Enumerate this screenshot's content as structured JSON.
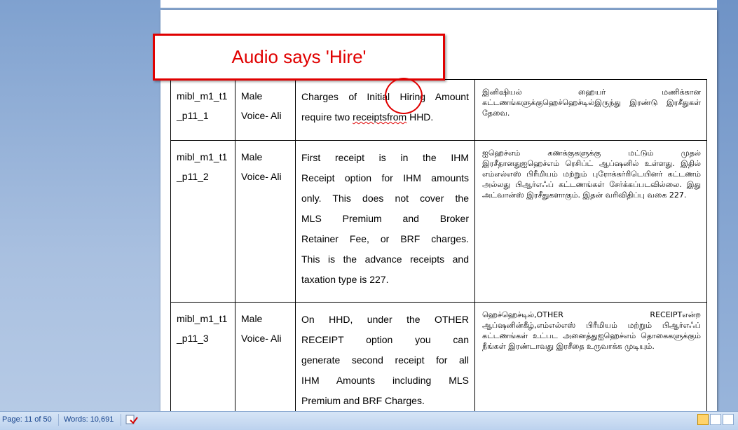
{
  "callout": {
    "text": "Audio says 'Hire'"
  },
  "table": {
    "rows": [
      {
        "id": "mibl_m1_t1_p11_1",
        "id_line1": "mibl_m1_t1",
        "id_line2": "_p11_1",
        "voice_line1": "Male",
        "voice_line2": "Voice- Ali",
        "english": {
          "pre": "Charges of Initial ",
          "highlight": "Hiring",
          "post": " Amount",
          "line2_pre": "require two ",
          "line2_spell": "receiptsfrom",
          "line2_post": " HHD."
        },
        "tamil": "இனிஷியல் ஹையர் மணிக்கான கட்டணங்களுக்குஹெச்ஹெச்டில்இருந்து இரண்டு இரசீதுகள் தேவை."
      },
      {
        "id": "mibl_m1_t1_p11_2",
        "id_line1": "mibl_m1_t1",
        "id_line2": "_p11_2",
        "voice_line1": "Male",
        "voice_line2": "Voice- Ali",
        "english_lines": [
          "First receipt is in the IHM",
          "Receipt option for IHM amounts",
          "only. This does not cover the",
          "MLS Premium and Broker",
          "Retainer Fee, or BRF charges.",
          "This is the advance receipts and",
          "taxation type is 227."
        ],
        "tamil": "ஐஹெச்எம் கணக்குகளுக்கு மட்டும் முதல் இரசீதானதுஐஹெச்எம் ரெசிப்ட் ஆப்ஷனில் உள்ளது. இதில் எம்எல்எஸ் பிரீமியம் மற்றும் புரோக்கர்ரிடெயினர் கட்டணம் அல்லது பிஆர்எஃப் கட்டணங்கள் சேர்க்கப்படவில்லை. இது அட்வான்ஸ் இரசீதுகளாகும். இதன் வரிவிதிப்பு வகை 227."
      },
      {
        "id": "mibl_m1_t1_p11_3",
        "id_line1": "mibl_m1_t1",
        "id_line2": "_p11_3",
        "voice_line1": "Male",
        "voice_line2": "Voice- Ali",
        "english_lines": [
          "On HHD, under the OTHER",
          "RECEIPT option you can",
          "generate second receipt for all",
          "IHM Amounts including MLS",
          "Premium and BRF Charges."
        ],
        "tamil": "ஹெச்ஹெச்டில்,OTHER RECEIPTஎன்ற ஆப்ஷனின்கீழ்,எம்எல்எஸ் பிரீமியம் மற்றும் பிஆர்எஃப் கட்டணங்கள் உட்பட அனைத்துஐஹெச்எம் தொகைகளுக்கும் நீங்கள் இரண்டாவது இரசீதை உருவாக்க முடியும்."
      }
    ]
  },
  "statusbar": {
    "page": "Page: 11 of 50",
    "words": "Words: 10,691"
  },
  "colors": {
    "accent": "#e00000",
    "status_text": "#15428b"
  }
}
